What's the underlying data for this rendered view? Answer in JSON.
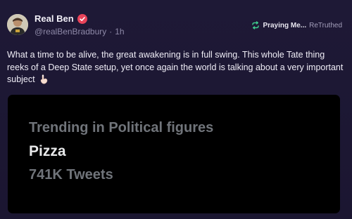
{
  "author": {
    "display_name": "Real Ben",
    "handle": "@realBenBradbury",
    "separator": "·",
    "time": "1h",
    "avatar_icon": "avatar-portrait",
    "verified_color": "#e8435a"
  },
  "retruth": {
    "icon": "retruth-arrows-icon",
    "icon_color": "#3fcf8e",
    "user": "Praying Me...",
    "label": "ReTruthed"
  },
  "post": {
    "text": "What a time to be alive, the great awakening is in full swing. This whole Tate thing reeks of a Deep State setup, yet once again the world is talking about a very important subject",
    "emoji": "pointing-down-hand"
  },
  "media": {
    "category": "Trending in Political figures",
    "topic": "Pizza",
    "count": "741K Tweets"
  },
  "colors": {
    "background": "#1c1733",
    "media_background": "#000000",
    "muted_text": "#70747a"
  }
}
